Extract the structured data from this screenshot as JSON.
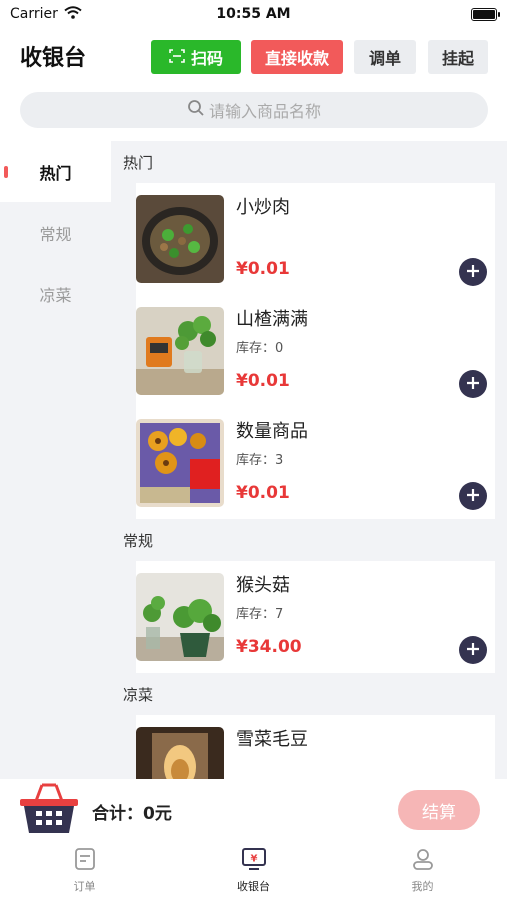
{
  "status_bar": {
    "carrier": "Carrier",
    "time": "10:55 AM",
    "battery_level": 1.0
  },
  "header": {
    "title": "收银台",
    "scan_label": "扫码",
    "direct_pay_label": "直接收款",
    "adjust_label": "调单",
    "hold_label": "挂起"
  },
  "search": {
    "placeholder": "请输入商品名称"
  },
  "categories": [
    {
      "label": "热门",
      "active": true
    },
    {
      "label": "常规",
      "active": false
    },
    {
      "label": "凉菜",
      "active": false
    }
  ],
  "sections": [
    {
      "title": "热门",
      "items": [
        {
          "name": "小炒肉",
          "stock": "",
          "price": "¥0.01"
        },
        {
          "name": "山楂满满",
          "stock": "库存：0",
          "price": "¥0.01"
        },
        {
          "name": "数量商品",
          "stock": "库存：3",
          "price": "¥0.01"
        }
      ]
    },
    {
      "title": "常规",
      "items": [
        {
          "name": "猴头菇",
          "stock": "库存：7",
          "price": "¥34.00"
        }
      ]
    },
    {
      "title": "凉菜",
      "items": [
        {
          "name": "雪菜毛豆",
          "stock": "",
          "price": ""
        }
      ]
    }
  ],
  "cart": {
    "total_text": "合计：0元",
    "checkout_label": "结算"
  },
  "tabs": [
    {
      "label": "订单",
      "icon": "order-icon",
      "active": false
    },
    {
      "label": "收银台",
      "icon": "cashier-icon",
      "active": true
    },
    {
      "label": "我的",
      "icon": "profile-icon",
      "active": false
    }
  ],
  "colors": {
    "primary": "#f25a5a",
    "scan_green": "#2ab82a",
    "price_red": "#e83838",
    "dark_button": "#343350"
  }
}
